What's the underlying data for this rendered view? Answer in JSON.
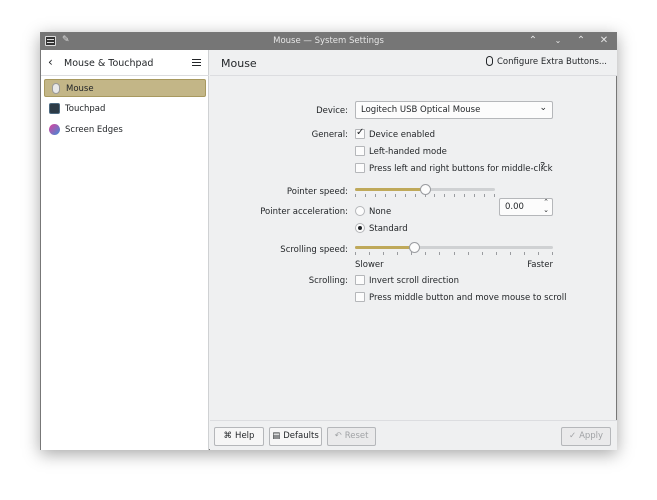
{
  "window": {
    "title": "Mouse — System Settings"
  },
  "sidebar": {
    "title": "Mouse & Touchpad",
    "items": [
      {
        "label": "Mouse",
        "icon": "mouse-icon",
        "active": true
      },
      {
        "label": "Touchpad",
        "icon": "touchpad-icon",
        "active": false
      },
      {
        "label": "Screen Edges",
        "icon": "screen-edges-icon",
        "active": false
      }
    ]
  },
  "main": {
    "title": "Mouse",
    "extra_button": "Configure Extra Buttons...",
    "device": {
      "label": "Device:",
      "value": "Logitech USB Optical Mouse"
    },
    "general": {
      "label": "General:",
      "options": [
        {
          "label": "Device enabled",
          "checked": true
        },
        {
          "label": "Left-handed mode",
          "checked": false
        },
        {
          "label": "Press left and right buttons for middle-click",
          "checked": false
        }
      ],
      "help": "?"
    },
    "pointer_speed": {
      "label": "Pointer speed:",
      "value": "0.00",
      "level": 0.5
    },
    "pointer_accel": {
      "label": "Pointer acceleration:",
      "options": [
        {
          "label": "None",
          "checked": false
        },
        {
          "label": "Standard",
          "checked": true
        }
      ]
    },
    "scrolling_speed": {
      "label": "Scrolling speed:",
      "level": 0.3,
      "min_label": "Slower",
      "max_label": "Faster"
    },
    "scrolling": {
      "label": "Scrolling:",
      "options": [
        {
          "label": "Invert scroll direction",
          "checked": false
        },
        {
          "label": "Press middle button and move mouse to scroll",
          "checked": false
        }
      ]
    }
  },
  "footer": {
    "help": "Help",
    "defaults": "Defaults",
    "reset": "Reset",
    "apply": "Apply"
  },
  "colors": {
    "accent": "#c3b687",
    "slider_fill": "#bfa95a"
  }
}
